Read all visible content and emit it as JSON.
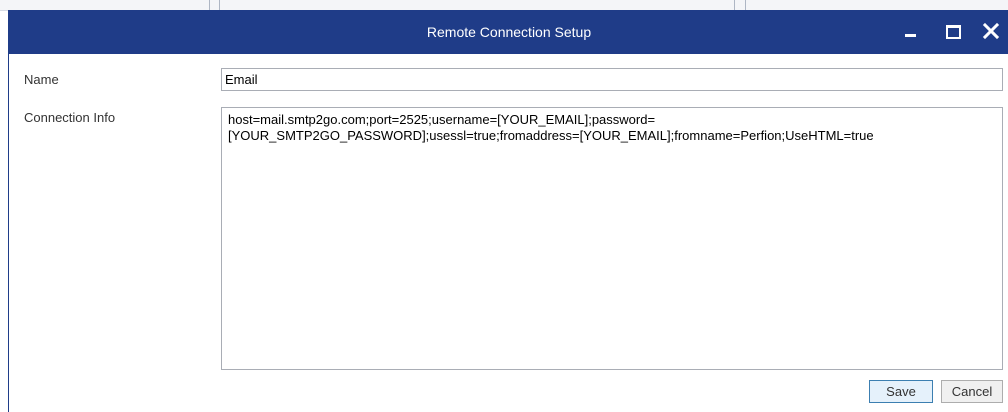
{
  "dialog": {
    "title": "Remote Connection Setup",
    "colors": {
      "titlebar": "#1f3c88",
      "title_text": "#ffffff"
    },
    "controls": {
      "minimize_icon": "minimize-icon",
      "maximize_icon": "maximize-icon",
      "close_icon": "close-icon"
    }
  },
  "form": {
    "name_label": "Name",
    "name_value": "Email",
    "connection_info_label": "Connection Info",
    "connection_info_value": "host=mail.smtp2go.com;port=2525;username=[YOUR_EMAIL];password=\n[YOUR_SMTP2GO_PASSWORD];usessl=true;fromaddress=[YOUR_EMAIL];fromname=Perfion;UseHTML=true"
  },
  "actions": {
    "save_label": "Save",
    "cancel_label": "Cancel"
  }
}
